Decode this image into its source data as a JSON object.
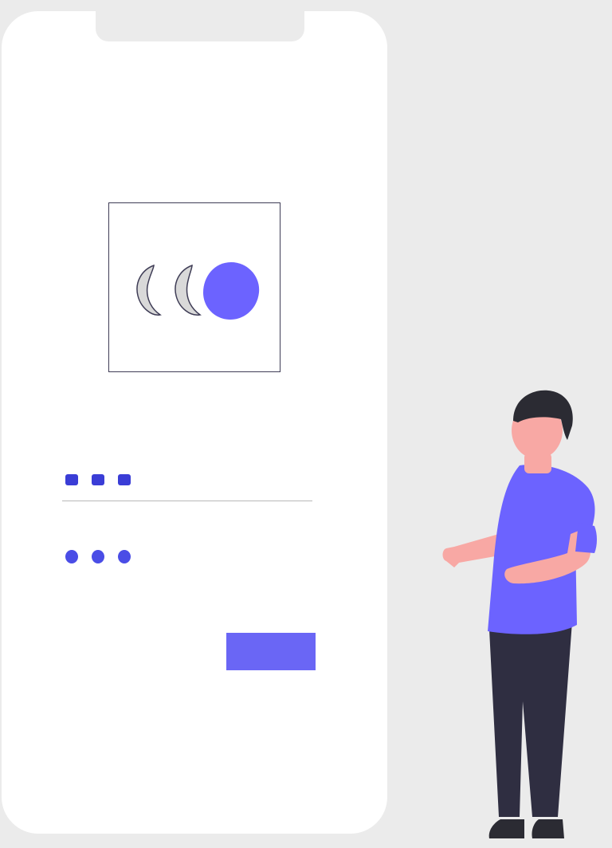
{
  "colors": {
    "background": "#ebebeb",
    "phone_body": "#ffffff",
    "accent": "#6a66f5",
    "dot_color": "#3a3dd6",
    "shirt": "#6c63ff",
    "skin": "#f8a8a4",
    "hair": "#2b2b33",
    "pants": "#2f2e41",
    "avatar_gray": "#e6e6e6"
  },
  "login_card": {
    "avatars": [
      "avatar-inactive",
      "avatar-inactive",
      "avatar-active"
    ],
    "username_dots": 3,
    "password_dots": 3
  },
  "icons": {
    "avatar": "person-avatar-icon",
    "illustration": "standing-person-illustration"
  }
}
